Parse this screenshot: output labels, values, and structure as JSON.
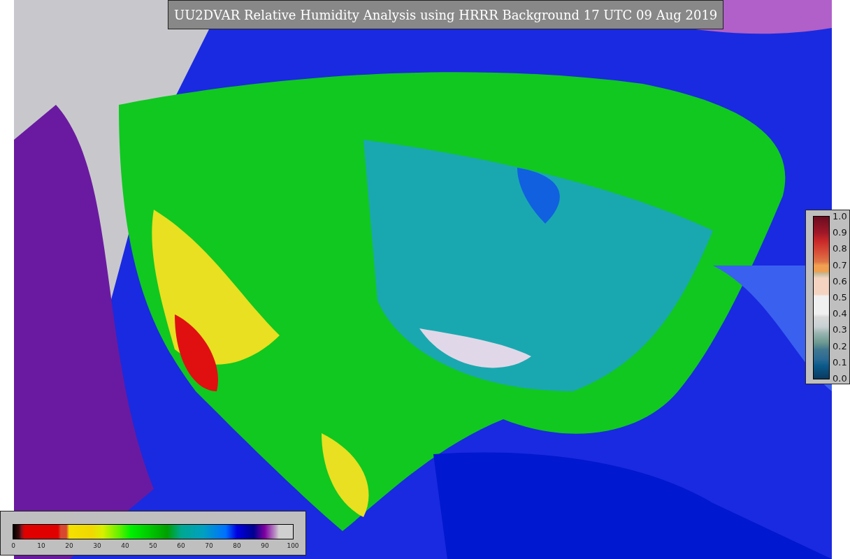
{
  "title": "UU2DVAR Relative Humidity Analysis using HRRR Background 17 UTC 09 Aug 2019",
  "colorbar_bottom": {
    "ticks": [
      "0",
      "10",
      "20",
      "30",
      "40",
      "50",
      "60",
      "70",
      "80",
      "90",
      "100"
    ]
  },
  "colorbar_right": {
    "ticks": [
      "1.0",
      "0.9",
      "0.8",
      "0.7",
      "0.6",
      "0.5",
      "0.4",
      "0.3",
      "0.2",
      "0.1",
      "0.0"
    ]
  }
}
